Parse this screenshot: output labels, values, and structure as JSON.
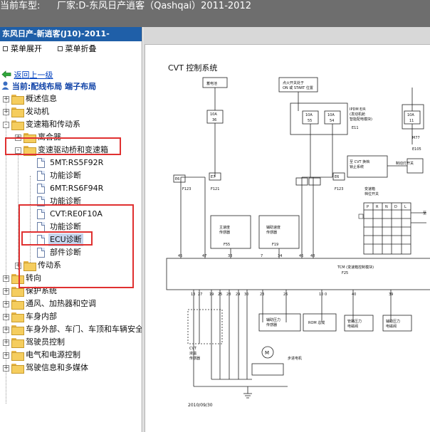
{
  "topbar": {
    "label": "当前车型:",
    "value": "厂家:D-东风日产逍客（Qashqai）2011-2012"
  },
  "sidebar": {
    "header": "东风日产-新逍客(J10)-2011-",
    "expand_all": "菜单展开",
    "collapse_all": "菜单折叠",
    "back": "返回上一级",
    "current": "当前:配线布局 端子布局",
    "tree": [
      {
        "label": "概述信息",
        "type": "folder",
        "toggle": "+"
      },
      {
        "label": "发动机",
        "type": "folder",
        "toggle": "+"
      },
      {
        "label": "变速箱和传动系",
        "type": "folder",
        "toggle": "-"
      },
      {
        "label": "离合器",
        "type": "folder",
        "toggle": "+"
      },
      {
        "label": "变速驱动桥和变速箱",
        "type": "folder",
        "toggle": "-"
      },
      {
        "label": "5MT:RS5F92R",
        "type": "doc"
      },
      {
        "label": "功能诊断",
        "type": "doc"
      },
      {
        "label": "6MT:RS6F94R",
        "type": "doc"
      },
      {
        "label": "功能诊断",
        "type": "doc"
      },
      {
        "label": "CVT:RE0F10A",
        "type": "doc"
      },
      {
        "label": "功能诊断",
        "type": "doc"
      },
      {
        "label": "ECU诊断",
        "type": "doc",
        "selected": true
      },
      {
        "label": "部件诊断",
        "type": "doc"
      },
      {
        "label": "传动系",
        "type": "folder",
        "toggle": "+"
      },
      {
        "label": "转向",
        "type": "folder",
        "toggle": "+"
      },
      {
        "label": "保护系统",
        "type": "folder",
        "toggle": "+"
      },
      {
        "label": "通风、加热器和空调",
        "type": "folder",
        "toggle": "+"
      },
      {
        "label": "车身内部",
        "type": "folder",
        "toggle": "+"
      },
      {
        "label": "车身外部、车门、车顶和车辆安全",
        "type": "folder",
        "toggle": "+"
      },
      {
        "label": "驾驶员控制",
        "type": "folder",
        "toggle": "+"
      },
      {
        "label": "电气和电源控制",
        "type": "folder",
        "toggle": "+"
      },
      {
        "label": "驾驶信息和多媒体",
        "type": "folder",
        "toggle": "+"
      }
    ]
  },
  "diagram": {
    "title": "CVT 控制系统",
    "battery": "蓄电池",
    "ignition_line1": "点火开关处于",
    "ignition_line2": "ON 或 START 位置",
    "ipdm_line1": "IPDM E/R",
    "ipdm_line2": "(发动机舱",
    "ipdm_line3": "智能配电模块)",
    "fuse_rating": "10A",
    "fuse_36": "36",
    "fuse_55": "55",
    "fuse_54": "54",
    "fuse_11": "11",
    "conn_e11": "E11",
    "conn_e105": "E105",
    "conn_m77": "M77",
    "conn_e6": "E6",
    "conn_e7": "E7",
    "conn_f123": "F123",
    "conn_f121": "F121",
    "shift_block_line1": "至 CVT 换档",
    "shift_block_line2": "锁止系统",
    "brake_lamp": "制动灯开关",
    "range_switch_line1": "变速箱",
    "range_switch_line2": "档位开关",
    "range_positions": [
      "P",
      "R",
      "N",
      "D",
      "L"
    ],
    "to_label": "至",
    "primary_sensor_line1": "主速度",
    "primary_sensor_line2": "传感器",
    "primary_sensor_conn": "F55",
    "secondary_sensor_line1": "辅助速度",
    "secondary_sensor_line2": "传感器",
    "secondary_sensor_conn": "F19",
    "tcm_label": "TCM (变速箱控制模块)",
    "tcm_conn": "F25",
    "cvt_temp_line1": "CVT",
    "cvt_temp_line2": "液温",
    "cvt_temp_line3": "传感器",
    "aux_pressure_line1": "辅助压力",
    "aux_pressure_line2": "传感器",
    "rom_label": "ROM 总成",
    "line_pressure_line1": "管路压力",
    "line_pressure_line2": "电磁阀",
    "aux_solenoid_line1": "辅助压力",
    "aux_solenoid_line2": "电磁阀",
    "step_motor": "步进电机",
    "motor_symbol": "M",
    "date": "2010/09/30",
    "pins_top": [
      "45",
      "47",
      "33",
      "7",
      "34",
      "46",
      "48"
    ],
    "pins_bottom": [
      "13",
      "27",
      "19",
      "25",
      "28",
      "29",
      "30",
      "23",
      "26",
      "10",
      "0",
      "40",
      "39"
    ],
    "pin_3": "3",
    "pin_2": "2",
    "pin_12": "12",
    "pin_16": "16",
    "pin_9": "9",
    "pin_1": "1",
    "pin_4": "4",
    "pin_77": "77"
  }
}
